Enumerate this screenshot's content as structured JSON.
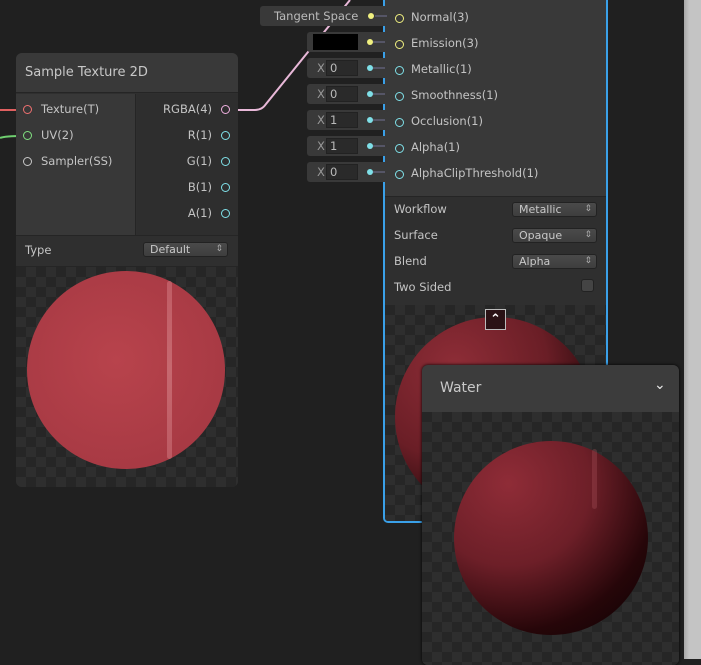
{
  "sample_node": {
    "title": "Sample Texture 2D",
    "inputs": [
      {
        "label": "Texture(T)",
        "color": "#f07070"
      },
      {
        "label": "UV(2)",
        "color": "#80e080"
      },
      {
        "label": "Sampler(SS)",
        "color": "#c8c8c8"
      }
    ],
    "outputs": [
      {
        "label": "RGBA(4)",
        "color": "#f0b0e0"
      },
      {
        "label": "R(1)",
        "color": "#7fe0e8"
      },
      {
        "label": "G(1)",
        "color": "#7fe0e8"
      },
      {
        "label": "B(1)",
        "color": "#7fe0e8"
      },
      {
        "label": "A(1)",
        "color": "#7fe0e8"
      }
    ],
    "type_label": "Type",
    "type_value": "Default"
  },
  "master_node": {
    "accent": "#3aa0e8",
    "inputs": [
      {
        "label": "Normal(3)",
        "color": "#f0f080",
        "field": "Tangent Space"
      },
      {
        "label": "Emission(3)",
        "color": "#f0f080",
        "field_color": "#000000"
      },
      {
        "label": "Metallic(1)",
        "color": "#7fe0e8",
        "x": "0"
      },
      {
        "label": "Smoothness(1)",
        "color": "#7fe0e8",
        "x": "0"
      },
      {
        "label": "Occlusion(1)",
        "color": "#7fe0e8",
        "x": "1"
      },
      {
        "label": "Alpha(1)",
        "color": "#7fe0e8",
        "x": "1"
      },
      {
        "label": "AlphaClipThreshold(1)",
        "color": "#7fe0e8",
        "x": "0"
      }
    ],
    "x_prefix": "X",
    "settings": [
      {
        "label": "Workflow",
        "value": "Metallic"
      },
      {
        "label": "Surface",
        "value": "Opaque"
      },
      {
        "label": "Blend",
        "value": "Alpha"
      }
    ],
    "two_sided": {
      "label": "Two Sided",
      "checked": false
    }
  },
  "preview_window": {
    "title": "Water",
    "icon": "chevron-down-icon"
  }
}
